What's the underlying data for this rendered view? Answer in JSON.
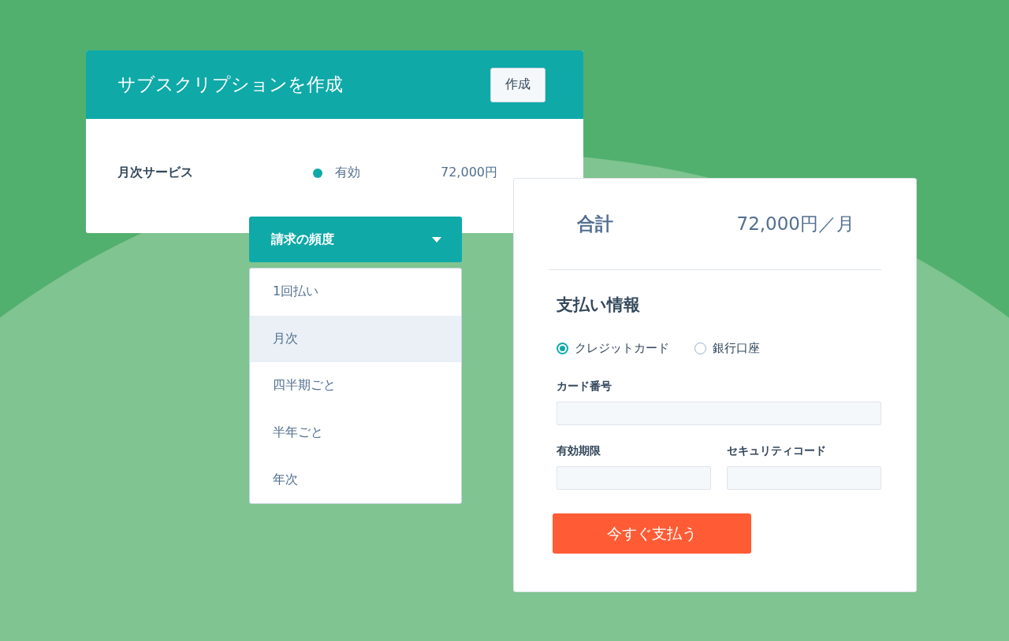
{
  "subscription_card": {
    "title": "サブスクリプションを作成",
    "button": "作成",
    "row": {
      "name": "月次サービス",
      "status": "有効",
      "price": "72,000円"
    }
  },
  "frequency_dropdown": {
    "label": "請求の頻度",
    "expanded": true,
    "options": [
      {
        "label": "1回払い",
        "selected": false
      },
      {
        "label": "月次",
        "selected": true
      },
      {
        "label": "四半期ごと",
        "selected": false
      },
      {
        "label": "半年ごと",
        "selected": false
      },
      {
        "label": "年次",
        "selected": false
      }
    ]
  },
  "payment_card": {
    "total_label": "合計",
    "total_value": "72,000円／月",
    "section_title": "支払い情報",
    "methods": [
      {
        "label": "クレジットカード",
        "selected": true
      },
      {
        "label": "銀行口座",
        "selected": false
      }
    ],
    "card_number_label": "カード番号",
    "expiry_label": "有効期限",
    "security_code_label": "セキュリティコード",
    "pay_button": "今すぐ支払う"
  }
}
